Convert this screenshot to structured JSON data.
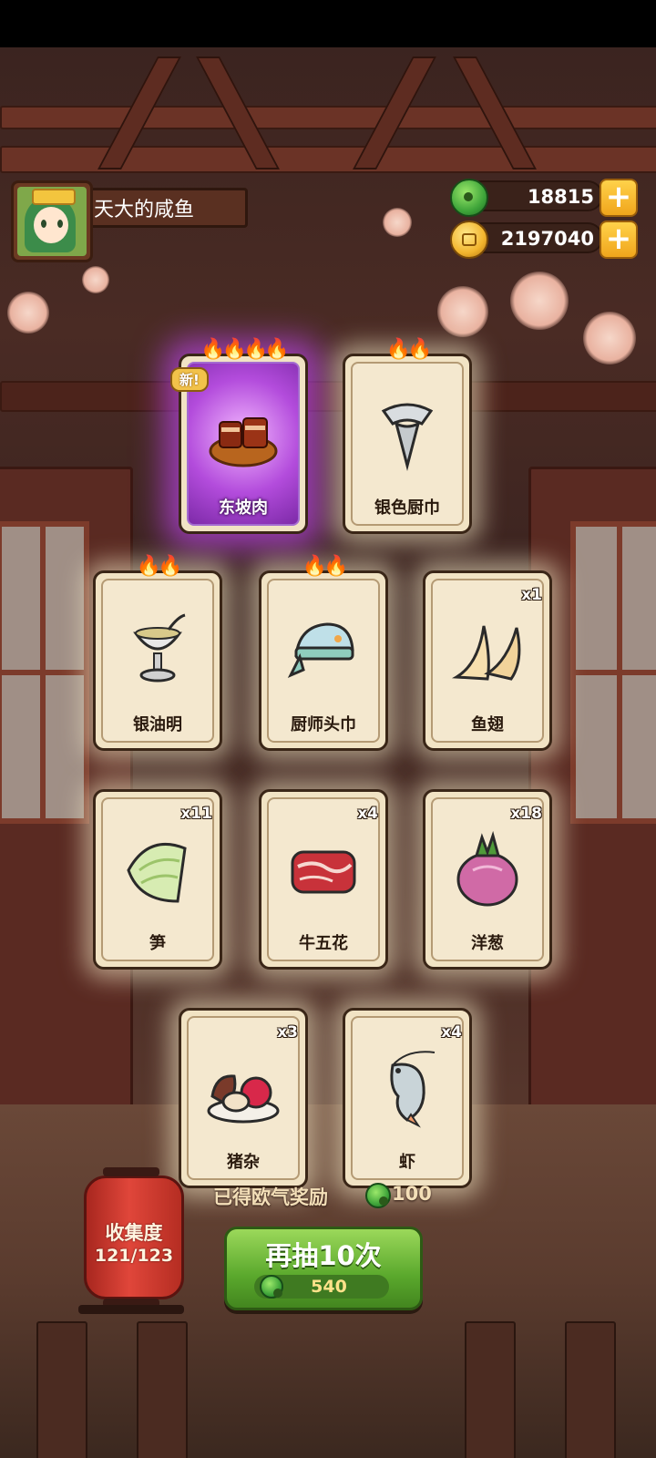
{
  "player": {
    "name": "天大的咸鱼"
  },
  "currency": {
    "jade": "18815",
    "coins": "2197040"
  },
  "cards": [
    {
      "name": "东坡肉",
      "count": "",
      "new_label": "新!",
      "rarity_flames": 4,
      "icon": "braised-pork-icon"
    },
    {
      "name": "银色厨巾",
      "count": "",
      "rarity_flames": 2,
      "icon": "silver-scarf-icon"
    },
    {
      "name": "银油明",
      "count": "",
      "rarity_flames": 2,
      "icon": "silver-goblet-icon"
    },
    {
      "name": "厨师头巾",
      "count": "",
      "rarity_flames": 2,
      "icon": "chef-headscarf-icon"
    },
    {
      "name": "鱼翅",
      "count": "x1",
      "icon": "shark-fin-icon"
    },
    {
      "name": "笋",
      "count": "x11",
      "icon": "bamboo-shoot-icon"
    },
    {
      "name": "牛五花",
      "count": "x4",
      "icon": "beef-belly-icon"
    },
    {
      "name": "洋葱",
      "count": "x18",
      "icon": "onion-icon"
    },
    {
      "name": "猪杂",
      "count": "x3",
      "icon": "pork-offal-icon"
    },
    {
      "name": "虾",
      "count": "x4",
      "icon": "shrimp-icon"
    }
  ],
  "collection": {
    "title": "收集度",
    "progress": "121/123"
  },
  "luck_reward": {
    "label": "已得欧气奖励",
    "amount": "100"
  },
  "redraw": {
    "label": "再抽10次",
    "cost": "540"
  },
  "colors": {
    "rare_glow": "#c748ff",
    "button_green": "#5aa82c",
    "lantern_red": "#d23c30"
  }
}
